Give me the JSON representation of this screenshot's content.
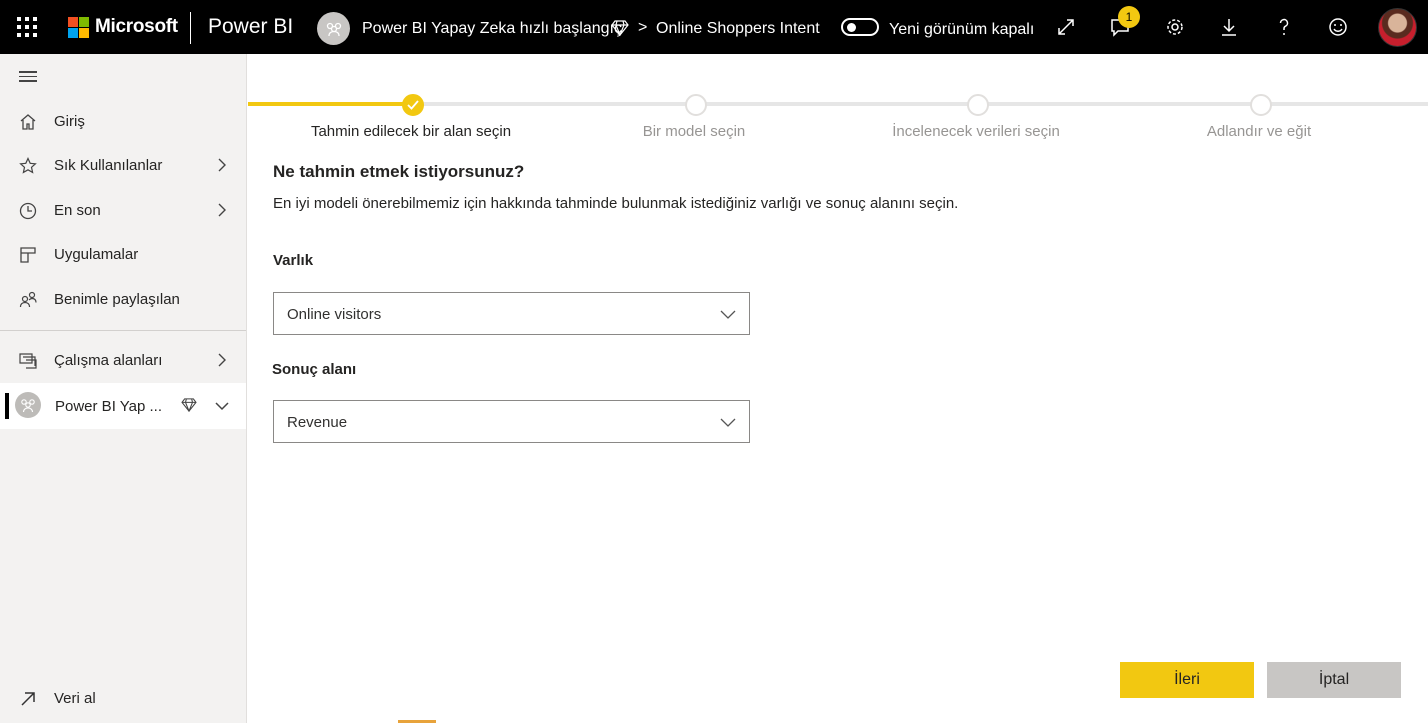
{
  "topbar": {
    "brand": "Microsoft",
    "app_name": "Power BI",
    "workspace": "Power BI Yapay Zeka hızlı başlangıç",
    "breadcrumb_sep": ">",
    "breadcrumb_item": "Online Shoppers Intent",
    "toggle_label": "Yeni görünüm kapalı",
    "notification_count": "1",
    "icons": [
      "waffle-icon",
      "people-icon",
      "diamond-icon",
      "expand-icon",
      "chat-icon",
      "gear-icon",
      "download-icon",
      "help-icon",
      "smiley-icon",
      "user-avatar"
    ],
    "colors": {
      "ms_red": "#f25022",
      "ms_green": "#7fba00",
      "ms_blue": "#00a4ef",
      "ms_yellow": "#ffb900",
      "accent": "#f2c811"
    }
  },
  "sidebar": {
    "items": [
      {
        "label": "Giriş",
        "icon": "home-icon"
      },
      {
        "label": "Sık Kullanılanlar",
        "icon": "star-icon"
      },
      {
        "label": "En son",
        "icon": "clock-icon"
      },
      {
        "label": "Uygulamalar",
        "icon": "apps-icon"
      },
      {
        "label": "Benimle paylaşılan",
        "icon": "shared-icon"
      },
      {
        "label": "Çalışma alanları",
        "icon": "workspaces-icon"
      }
    ],
    "current_workspace": "Power BI Yap ...",
    "get_data": "Veri al"
  },
  "wizard": {
    "steps": [
      "Tahmin edilecek bir alan seçin",
      "Bir model seçin",
      "İncelenecek verileri seçin",
      "Adlandır ve eğit"
    ],
    "heading": "Ne tahmin etmek istiyorsunuz?",
    "description": "En iyi modeli önerebilmemiz için hakkında tahminde bulunmak istediğiniz varlığı ve sonuç alanını seçin.",
    "entity_label": "Varlık",
    "entity_value": "Online visitors",
    "outcome_label": "Sonuç alanı",
    "outcome_value": "Revenue",
    "next_button": "İleri",
    "cancel_button": "İptal"
  }
}
